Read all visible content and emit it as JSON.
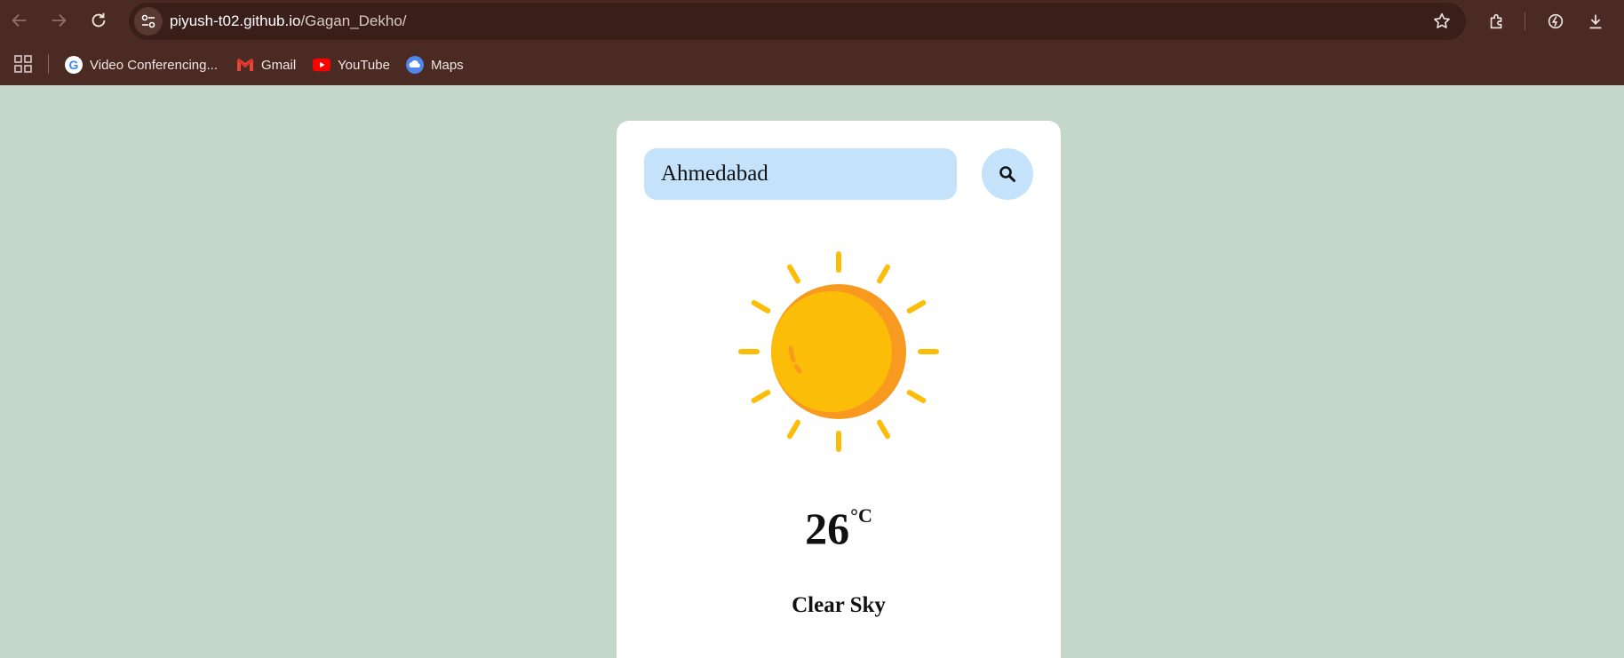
{
  "browser": {
    "url_host": "piyush-t02.github.io",
    "url_path": "/Gagan_Dekho/",
    "bookmarks": [
      {
        "label": "Video Conferencing...",
        "icon": "google-icon"
      },
      {
        "label": "Gmail",
        "icon": "gmail-icon"
      },
      {
        "label": "YouTube",
        "icon": "youtube-icon"
      },
      {
        "label": "Maps",
        "icon": "maps-icon"
      }
    ]
  },
  "weather": {
    "city_input_value": "Ahmedabad",
    "search_icon": "search-icon",
    "weather_icon": "sun-icon",
    "temperature": "26",
    "unit": "°C",
    "description": "Clear Sky"
  },
  "colors": {
    "page_background": "#c3d6c9",
    "browser_chrome": "#4c2a24",
    "input_background": "#c4e3fb",
    "sun_primary": "#fbbd07",
    "sun_shadow": "#f79a1f"
  }
}
